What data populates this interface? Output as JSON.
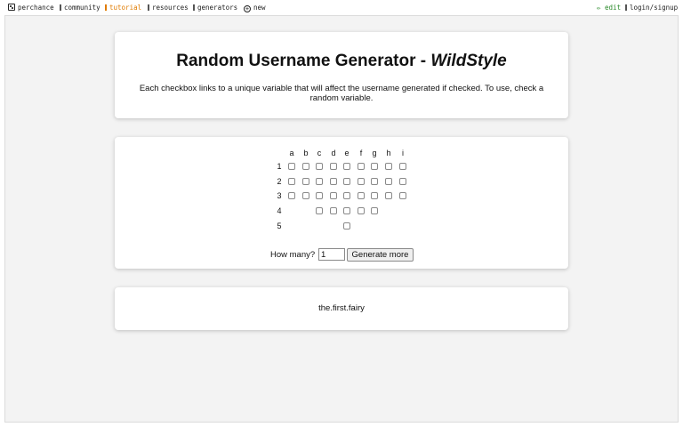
{
  "nav": {
    "brand": "perchance",
    "community": "community",
    "tutorial": "tutorial",
    "resources": "resources",
    "generators": "generators",
    "new": "new",
    "edit": "✏ edit",
    "login": "login/signup"
  },
  "title_main": "Random Username Generator - ",
  "title_em": "WildStyle",
  "description": "Each checkbox links to a unique variable that will affect the username generated if checked. To use, check a random variable.",
  "grid": {
    "columns": [
      "a",
      "b",
      "c",
      "d",
      "e",
      "f",
      "g",
      "h",
      "i"
    ],
    "rows": [
      "1",
      "2",
      "3",
      "4",
      "5"
    ],
    "cells": [
      [
        false,
        false,
        false,
        false,
        false,
        false,
        false,
        false,
        false
      ],
      [
        false,
        false,
        false,
        false,
        false,
        false,
        false,
        false,
        false
      ],
      [
        false,
        false,
        false,
        false,
        false,
        false,
        false,
        false,
        false
      ],
      [
        null,
        null,
        false,
        false,
        false,
        false,
        false,
        null,
        null
      ],
      [
        null,
        null,
        null,
        null,
        false,
        null,
        null,
        null,
        null
      ]
    ]
  },
  "how_many_label": "How many?",
  "how_many_value": "1",
  "generate_label": "Generate more",
  "result_text": "the.first.fairy",
  "colors": {
    "accent_orange": "#e07b00",
    "edit_green": "#2a8a2a",
    "background": "#f3f3f3"
  }
}
